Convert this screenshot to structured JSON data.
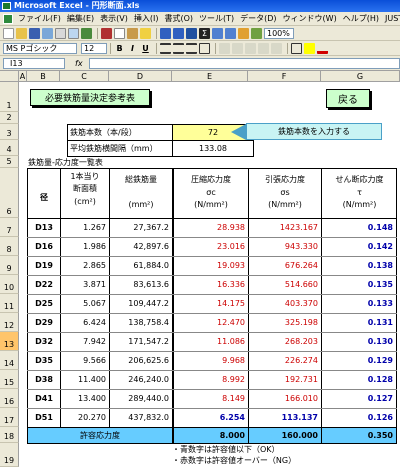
{
  "window": {
    "title": "Microsoft Excel - 円形断面.xls"
  },
  "menu": {
    "items": [
      "ファイル(F)",
      "編集(E)",
      "表示(V)",
      "挿入(I)",
      "書式(O)",
      "ツール(T)",
      "データ(D)",
      "ウィンドウ(W)",
      "ヘルプ(H)",
      "JUST PD"
    ]
  },
  "toolbar": {
    "font_name": "MS Pゴシック",
    "font_size": "12",
    "bold": "B",
    "italic": "I",
    "underline": "U",
    "zoom": "100%"
  },
  "formula_bar": {
    "name_box": "I13",
    "fx": "fx",
    "content": ""
  },
  "columns": [
    "A",
    "B",
    "C",
    "D",
    "E",
    "F",
    "G"
  ],
  "rows": [
    "1",
    "2",
    "3",
    "4",
    "5",
    "6",
    "7",
    "8",
    "9",
    "10",
    "11",
    "12",
    "13",
    "14",
    "15",
    "16",
    "17",
    "18",
    "19"
  ],
  "selected_row": "13",
  "sheet": {
    "title_button": "必要鉄筋量決定参考表",
    "back_button": "戻る",
    "bar_count_label": "鉄筋本数（本/段）",
    "bar_count_value": "72",
    "avg_spacing_label": "平均鉄筋横間隔（mm）",
    "avg_spacing_value": "133.08",
    "callout": "鉄筋本数を入力する",
    "section_title": "鉄筋量-応力度一覧表",
    "headers": {
      "diameter": "径",
      "unit_area": [
        "1本当り",
        "断面積",
        "(cm²)"
      ],
      "total_area": [
        "総鉄筋量",
        "(mm²)"
      ],
      "compressive": [
        "圧縮応力度",
        "σc",
        "(N/mm²)"
      ],
      "tensile": [
        "引張応力度",
        "σs",
        "(N/mm²)"
      ],
      "shear": [
        "せん断応力度",
        "τ",
        "(N/mm²)"
      ]
    },
    "table": [
      {
        "d": "D13",
        "a": "1.267",
        "t": "27,367.2",
        "sc": "28.938",
        "ss": "1423.167",
        "tau": "0.148"
      },
      {
        "d": "D16",
        "a": "1.986",
        "t": "42,897.6",
        "sc": "23.016",
        "ss": "943.330",
        "tau": "0.142"
      },
      {
        "d": "D19",
        "a": "2.865",
        "t": "61,884.0",
        "sc": "19.093",
        "ss": "676.264",
        "tau": "0.138"
      },
      {
        "d": "D22",
        "a": "3.871",
        "t": "83,613.6",
        "sc": "16.336",
        "ss": "514.660",
        "tau": "0.135"
      },
      {
        "d": "D25",
        "a": "5.067",
        "t": "109,447.2",
        "sc": "14.175",
        "ss": "403.370",
        "tau": "0.133"
      },
      {
        "d": "D29",
        "a": "6.424",
        "t": "138,758.4",
        "sc": "12.470",
        "ss": "325.198",
        "tau": "0.131"
      },
      {
        "d": "D32",
        "a": "7.942",
        "t": "171,547.2",
        "sc": "11.086",
        "ss": "268.203",
        "tau": "0.130"
      },
      {
        "d": "D35",
        "a": "9.566",
        "t": "206,625.6",
        "sc": "9.968",
        "ss": "226.274",
        "tau": "0.129"
      },
      {
        "d": "D38",
        "a": "11.400",
        "t": "246,240.0",
        "sc": "8.992",
        "ss": "192.731",
        "tau": "0.128"
      },
      {
        "d": "D41",
        "a": "13.400",
        "t": "289,440.0",
        "sc": "8.149",
        "ss": "166.010",
        "tau": "0.127"
      },
      {
        "d": "D51",
        "a": "20.270",
        "t": "437,832.0",
        "sc": "6.254",
        "ss": "113.137",
        "tau": "0.126"
      }
    ],
    "allowable_label": "許容応力度",
    "allowable": {
      "sc": "8.000",
      "ss": "160.000",
      "tau": "0.350"
    },
    "note_blue": "・青数字は許容値以下（OK）",
    "note_red": "・赤数字は許容値オーバー（NG）"
  },
  "colors": {
    "red_ng": "#cc0000",
    "blue_ok": "#0000aa",
    "input_fill": "#ffff99",
    "button_fill": "#ccffcc",
    "footer_fill": "#66ccff"
  }
}
